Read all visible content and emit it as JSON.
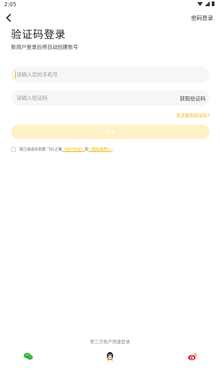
{
  "status_bar": {
    "time": "2:05"
  },
  "header": {
    "password_login_label": "密码登录"
  },
  "title": "验证码登录",
  "subtitle": "新用户登录后将自动创建账号",
  "phone_input": {
    "placeholder": "请输入您的手机号",
    "value": ""
  },
  "code_input": {
    "placeholder": "请输入验证码",
    "value": "",
    "get_code_label": "获取验证码"
  },
  "no_code_link": "无法收到验证码?",
  "login_button": "登录",
  "agreement": {
    "prefix": "我已阅读并同意 飞行之翼",
    "user_agreement": "《用户协议》",
    "and": "和",
    "privacy_policy": "《隐私政策》",
    "suffix": "。"
  },
  "third_party": {
    "label": "第三方账户快速登录"
  },
  "colors": {
    "accent": "#f0b400",
    "button_bg": "#fdf1c7",
    "field_bg": "#f6f6f6"
  },
  "icons": [
    "wechat-icon",
    "qq-icon",
    "weibo-icon"
  ]
}
